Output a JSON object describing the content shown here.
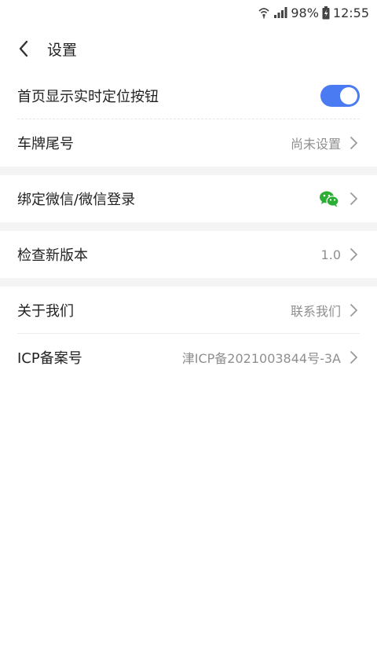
{
  "status_bar": {
    "battery": "98%",
    "time": "12:55"
  },
  "header": {
    "title": "设置"
  },
  "settings": {
    "locate_button": {
      "label": "首页显示实时定位按钮",
      "enabled": true
    },
    "plate_tail": {
      "label": "车牌尾号",
      "value": "尚未设置"
    },
    "wechat_bind": {
      "label": "绑定微信/微信登录"
    },
    "check_version": {
      "label": "检查新版本",
      "value": "1.0"
    },
    "about_us": {
      "label": "关于我们",
      "value": "联系我们"
    },
    "icp": {
      "label": "ICP备案号",
      "value": "津ICP备2021003844号-3A"
    }
  },
  "colors": {
    "toggle_on": "#4a7bf2",
    "wechat_green": "#2aae34",
    "secondary_text": "#8f8f8f"
  },
  "icons": [
    "wifi-icon",
    "signal-icon",
    "battery-icon",
    "back-arrow-icon",
    "chevron-right-icon",
    "wechat-icon"
  ]
}
